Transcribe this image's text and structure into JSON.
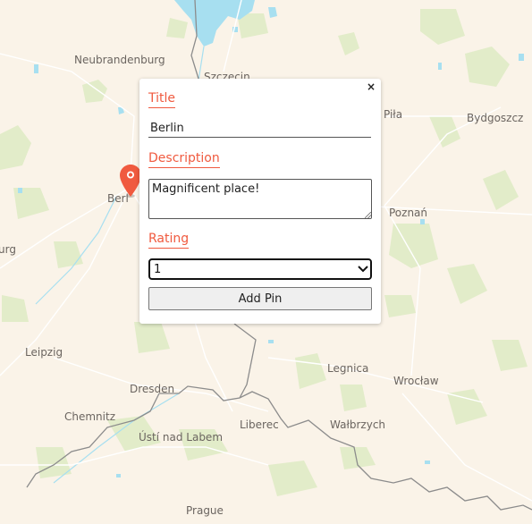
{
  "map": {
    "cities": [
      {
        "id": "neubrandenburg",
        "name": "Neubrandenburg"
      },
      {
        "id": "szczecin",
        "name": "Szczecin"
      },
      {
        "id": "pila",
        "name": "Piła"
      },
      {
        "id": "bydgoszcz",
        "name": "Bydgoszcz"
      },
      {
        "id": "berlin",
        "name": "Berl"
      },
      {
        "id": "poznan",
        "name": "Poznań"
      },
      {
        "id": "burg",
        "name": "urg"
      },
      {
        "id": "leipzig",
        "name": "Leipzig"
      },
      {
        "id": "legnica",
        "name": "Legnica"
      },
      {
        "id": "wroclaw",
        "name": "Wrocław"
      },
      {
        "id": "dresden",
        "name": "Dresden"
      },
      {
        "id": "chemnitz",
        "name": "Chemnitz"
      },
      {
        "id": "liberec",
        "name": "Liberec"
      },
      {
        "id": "walbrzych",
        "name": "Wałbrzych"
      },
      {
        "id": "usti",
        "name": "Ústí nad Labem"
      },
      {
        "id": "prague",
        "name": "Prague"
      }
    ],
    "pin_color": "#f05a3f"
  },
  "popup": {
    "close_label": "×",
    "title_label": "Title",
    "title_value": "Berlin",
    "description_label": "Description",
    "description_value": "Magnificent place!",
    "rating_label": "Rating",
    "rating_value": "1",
    "submit_label": "Add Pin",
    "accent_color": "#f05a3f"
  }
}
